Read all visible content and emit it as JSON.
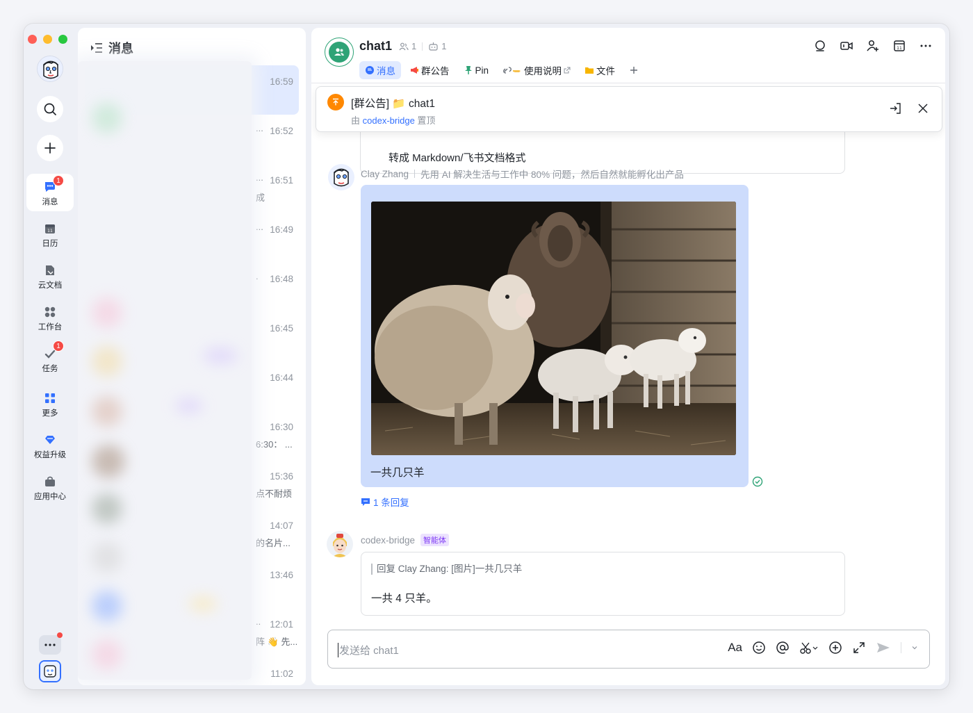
{
  "rail": {
    "items": [
      {
        "label": "消息",
        "badge": "1"
      },
      {
        "label": "日历"
      },
      {
        "label": "云文档"
      },
      {
        "label": "工作台"
      },
      {
        "label": "任务",
        "badge": "1"
      },
      {
        "label": "更多"
      },
      {
        "label": "权益升级"
      },
      {
        "label": "应用中心"
      }
    ]
  },
  "list": {
    "title": "消息",
    "rows": [
      {
        "time": "16:59",
        "tail": "",
        "snippet": ""
      },
      {
        "time": "16:52",
        "tail": "...",
        "snippet": ""
      },
      {
        "time": "16:51",
        "tail": "...",
        "snippet": "成"
      },
      {
        "time": "16:49",
        "tail": "...",
        "snippet": ""
      },
      {
        "time": "16:48",
        "tail": ".",
        "snippet": ""
      },
      {
        "time": "16:45",
        "tail": "",
        "snippet": ""
      },
      {
        "time": "16:44",
        "tail": "",
        "snippet": ""
      },
      {
        "time": "16:30",
        "tail": "",
        "snippet": "6:30： ..."
      },
      {
        "time": "15:36",
        "tail": "",
        "snippet": "点不耐烦"
      },
      {
        "time": "14:07",
        "tail": "",
        "snippet": "的名片..."
      },
      {
        "time": "13:46",
        "tail": "",
        "snippet": ""
      },
      {
        "time": "12:01",
        "tail": "..",
        "snippet": "阵 👋 先..."
      },
      {
        "time": "11:02",
        "tail": "",
        "snippet": ""
      }
    ]
  },
  "chat": {
    "title": "chat1",
    "member_count": "1",
    "bot_count": "1",
    "tabs": [
      {
        "label": "消息"
      },
      {
        "label": "群公告"
      },
      {
        "label": "Pin"
      },
      {
        "label": "使用说明"
      },
      {
        "label": "文件"
      }
    ]
  },
  "pinned": {
    "title": "[群公告] 📁 chat1",
    "prefix": "由",
    "by": "codex-bridge",
    "suffix": "置顶"
  },
  "prev_message": {
    "text": "转成 Markdown/飞书文档格式"
  },
  "message1": {
    "sender": "Clay Zhang",
    "signature": "先用 AI 解决生活与工作中 80% 问题，然后自然就能孵化出产品",
    "caption": "一共几只羊",
    "replies": "1 条回复"
  },
  "message2": {
    "sender": "codex-bridge",
    "tag": "智能体",
    "quote": "回复 Clay Zhang: [图片]一共几只羊",
    "answer": "一共 4 只羊。"
  },
  "composer": {
    "placeholder": "发送给 chat1",
    "format_label": "Aa"
  },
  "colors": {
    "accent": "#3370ff",
    "badge": "#f54a45",
    "group_avatar": "#2ea376",
    "pin_orange": "#ff8800",
    "ai_tag": "#7f3bf5"
  }
}
